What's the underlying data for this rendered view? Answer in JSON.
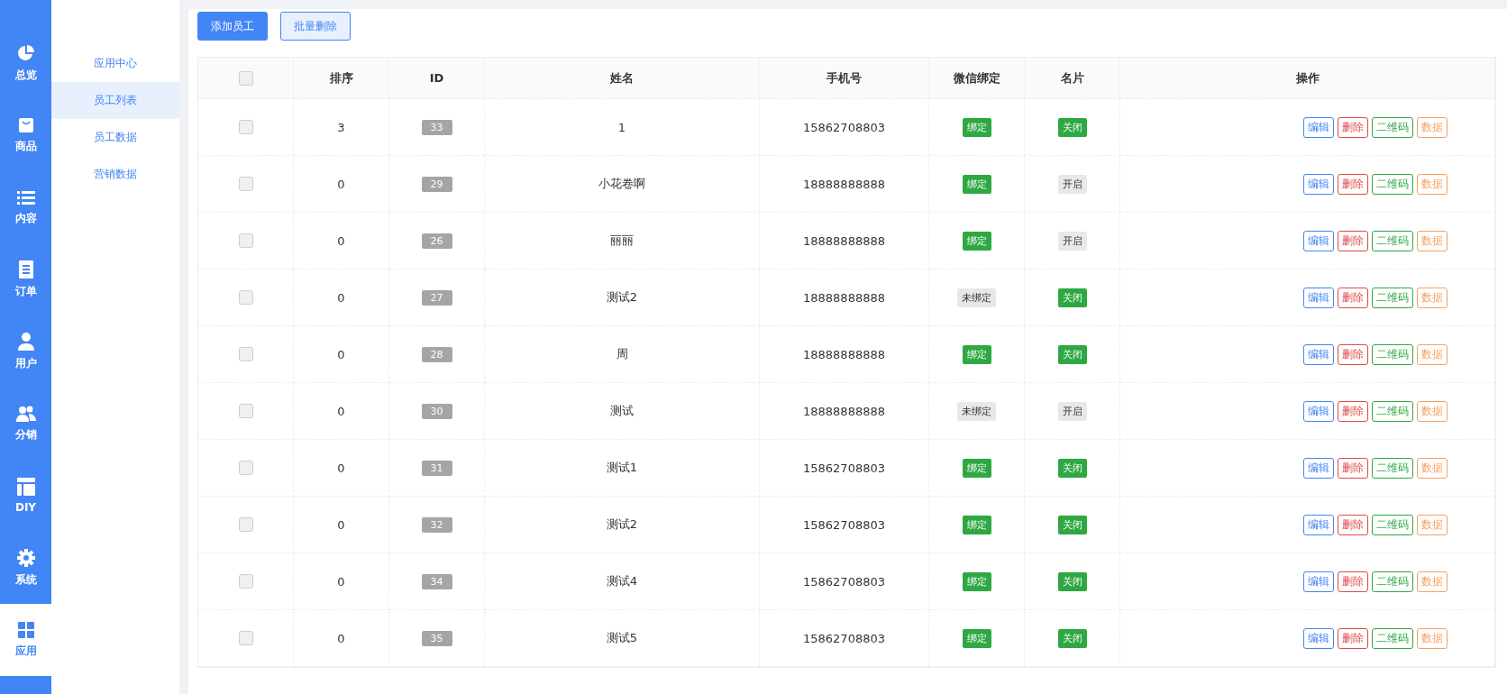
{
  "rail": [
    {
      "label": "总览",
      "selected": false
    },
    {
      "label": "商品",
      "selected": false
    },
    {
      "label": "内容",
      "selected": false
    },
    {
      "label": "订单",
      "selected": false
    },
    {
      "label": "用户",
      "selected": false
    },
    {
      "label": "分销",
      "selected": false
    },
    {
      "label": "DIY",
      "selected": false
    },
    {
      "label": "系统",
      "selected": false
    },
    {
      "label": "应用",
      "selected": true
    }
  ],
  "submenu": [
    {
      "label": "应用中心",
      "selected": false
    },
    {
      "label": "员工列表",
      "selected": true
    },
    {
      "label": "员工数据",
      "selected": false
    },
    {
      "label": "营销数据",
      "selected": false
    }
  ],
  "toolbar": {
    "add_button": "添加员工",
    "batch_delete_button": "批量删除"
  },
  "table": {
    "select_all_checked": false,
    "columns": [
      "排序",
      "ID",
      "姓名",
      "手机号",
      "微信绑定",
      "名片",
      "操作"
    ],
    "rows": [
      {
        "checked": false,
        "sort": "3",
        "id": "33",
        "name": "1",
        "phone": "15862708803",
        "wechat": {
          "label": "绑定",
          "active": true
        },
        "card": {
          "label": "关闭",
          "active": true
        },
        "actions": [
          "编辑",
          "删除",
          "二维码",
          "数据"
        ]
      },
      {
        "checked": false,
        "sort": "0",
        "id": "29",
        "name": "小花卷啊",
        "phone": "18888888888",
        "wechat": {
          "label": "绑定",
          "active": true
        },
        "card": {
          "label": "开启",
          "active": false
        },
        "actions": [
          "编辑",
          "删除",
          "二维码",
          "数据"
        ]
      },
      {
        "checked": false,
        "sort": "0",
        "id": "26",
        "name": "丽丽",
        "phone": "18888888888",
        "wechat": {
          "label": "绑定",
          "active": true
        },
        "card": {
          "label": "开启",
          "active": false
        },
        "actions": [
          "编辑",
          "删除",
          "二维码",
          "数据"
        ]
      },
      {
        "checked": false,
        "sort": "0",
        "id": "27",
        "name": "测试2",
        "phone": "18888888888",
        "wechat": {
          "label": "未绑定",
          "active": false
        },
        "card": {
          "label": "关闭",
          "active": true
        },
        "actions": [
          "编辑",
          "删除",
          "二维码",
          "数据"
        ]
      },
      {
        "checked": false,
        "sort": "0",
        "id": "28",
        "name": "周",
        "phone": "18888888888",
        "wechat": {
          "label": "绑定",
          "active": true
        },
        "card": {
          "label": "关闭",
          "active": true
        },
        "actions": [
          "编辑",
          "删除",
          "二维码",
          "数据"
        ]
      },
      {
        "checked": false,
        "sort": "0",
        "id": "30",
        "name": "测试",
        "phone": "18888888888",
        "wechat": {
          "label": "未绑定",
          "active": false
        },
        "card": {
          "label": "开启",
          "active": false
        },
        "actions": [
          "编辑",
          "删除",
          "二维码",
          "数据"
        ]
      },
      {
        "checked": false,
        "sort": "0",
        "id": "31",
        "name": "测试1",
        "phone": "15862708803",
        "wechat": {
          "label": "绑定",
          "active": true
        },
        "card": {
          "label": "关闭",
          "active": true
        },
        "actions": [
          "编辑",
          "删除",
          "二维码",
          "数据"
        ]
      },
      {
        "checked": false,
        "sort": "0",
        "id": "32",
        "name": "测试2",
        "phone": "15862708803",
        "wechat": {
          "label": "绑定",
          "active": true
        },
        "card": {
          "label": "关闭",
          "active": true
        },
        "actions": [
          "编辑",
          "删除",
          "二维码",
          "数据"
        ]
      },
      {
        "checked": false,
        "sort": "0",
        "id": "34",
        "name": "测试4",
        "phone": "15862708803",
        "wechat": {
          "label": "绑定",
          "active": true
        },
        "card": {
          "label": "关闭",
          "active": true
        },
        "actions": [
          "编辑",
          "删除",
          "二维码",
          "数据"
        ]
      },
      {
        "checked": false,
        "sort": "0",
        "id": "35",
        "name": "测试5",
        "phone": "15862708803",
        "wechat": {
          "label": "绑定",
          "active": true
        },
        "card": {
          "label": "关闭",
          "active": true
        },
        "actions": [
          "编辑",
          "删除",
          "二维码",
          "数据"
        ]
      }
    ]
  }
}
